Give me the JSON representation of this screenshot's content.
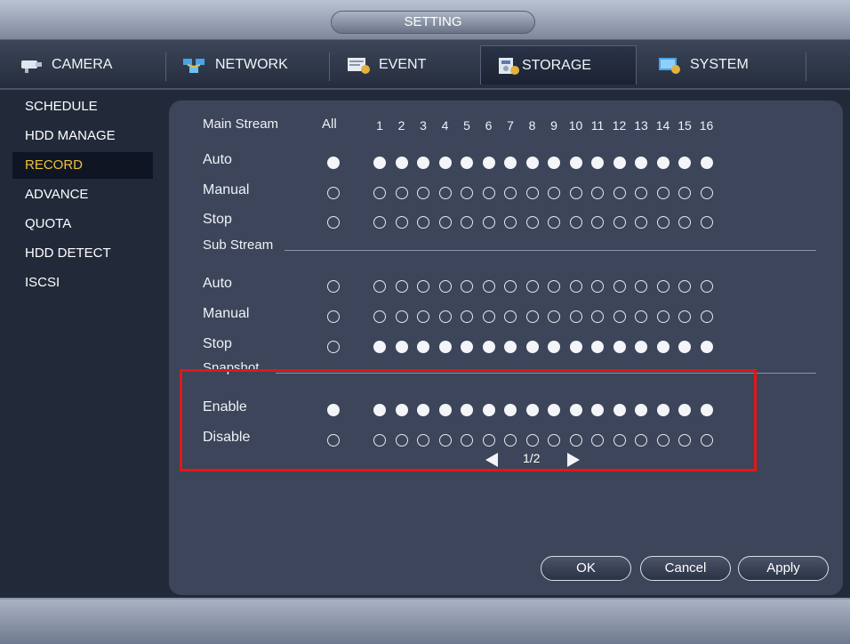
{
  "window": {
    "title": "SETTING"
  },
  "tabs": [
    {
      "label": "CAMERA",
      "icon": "camera-icon",
      "active": false
    },
    {
      "label": "NETWORK",
      "icon": "network-icon",
      "active": false
    },
    {
      "label": "EVENT",
      "icon": "event-icon",
      "active": false
    },
    {
      "label": "STORAGE",
      "icon": "storage-icon",
      "active": true
    },
    {
      "label": "SYSTEM",
      "icon": "system-icon",
      "active": false
    }
  ],
  "sidebar": {
    "items": [
      {
        "label": "SCHEDULE",
        "active": false
      },
      {
        "label": "HDD MANAGE",
        "active": false
      },
      {
        "label": "RECORD",
        "active": true
      },
      {
        "label": "ADVANCE",
        "active": false
      },
      {
        "label": "QUOTA",
        "active": false
      },
      {
        "label": "HDD DETECT",
        "active": false
      },
      {
        "label": "ISCSI",
        "active": false
      }
    ]
  },
  "record": {
    "main_stream_label": "Main Stream",
    "all_label": "All",
    "channels": [
      "1",
      "2",
      "3",
      "4",
      "5",
      "6",
      "7",
      "8",
      "9",
      "10",
      "11",
      "12",
      "13",
      "14",
      "15",
      "16"
    ],
    "main_stream_rows": [
      {
        "label": "Auto",
        "all": true,
        "selected": true
      },
      {
        "label": "Manual",
        "all": false,
        "selected": false
      },
      {
        "label": "Stop",
        "all": false,
        "selected": false
      }
    ],
    "sub_stream_label": "Sub Stream",
    "sub_stream_rows": [
      {
        "label": "Auto",
        "all": false,
        "selected": false
      },
      {
        "label": "Manual",
        "all": false,
        "selected": false
      },
      {
        "label": "Stop",
        "all": false,
        "selected": true
      }
    ],
    "snapshot_label": "Snapshot",
    "snapshot_rows": [
      {
        "label": "Enable",
        "all": true,
        "selected": true
      },
      {
        "label": "Disable",
        "all": false,
        "selected": false
      }
    ],
    "page": "1/2"
  },
  "buttons": {
    "ok": "OK",
    "cancel": "Cancel",
    "apply": "Apply"
  }
}
